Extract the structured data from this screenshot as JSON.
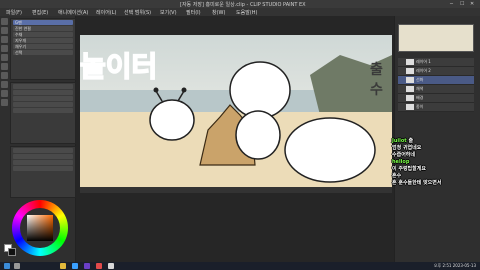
{
  "window": {
    "title": "[자동 저장] 흥미로운 일상.clip - CLIP STUDIO PAINT EX"
  },
  "menu": [
    "파일(F)",
    "편집(E)",
    "애니메이션(A)",
    "레이어(L)",
    "선택 범위(S)",
    "보기(V)",
    "필터(I)",
    "창(W)",
    "도움말(H)"
  ],
  "left_panel": {
    "tool_names": [
      "pen-tool",
      "pencil-tool",
      "brush-tool",
      "eraser-tool",
      "fill-tool",
      "select-tool",
      "move-tool",
      "text-tool"
    ],
    "sub_tools": [
      "G펜",
      "진한 연필",
      "수채",
      "지우개",
      "채우기",
      "선택"
    ]
  },
  "canvas": {
    "overlay_text": "놀이터",
    "side_text": "출수"
  },
  "right_panel": {
    "layers": [
      "레이어 1",
      "레이어 2",
      "선화",
      "채색",
      "배경",
      "종이"
    ]
  },
  "chat": {
    "lines": [
      {
        "name": "Juilot",
        "msg": "출"
      },
      {
        "name": "",
        "msg": "엄청 귀엽네요"
      },
      {
        "name": "",
        "msg": "수줍어하네"
      },
      {
        "name": "hellop",
        "msg": ""
      },
      {
        "name": "",
        "msg": "이 주렁팁할게요"
      },
      {
        "name": "",
        "msg": "흔수"
      },
      {
        "name": "",
        "msg": "흔 훈수들한테 맞으면서"
      }
    ]
  },
  "taskbar": {
    "time": "오후 2:51",
    "date": "2023-05-13"
  },
  "colors": {
    "accent": "#8a3fc6",
    "chat_name": "#7dff4a"
  }
}
